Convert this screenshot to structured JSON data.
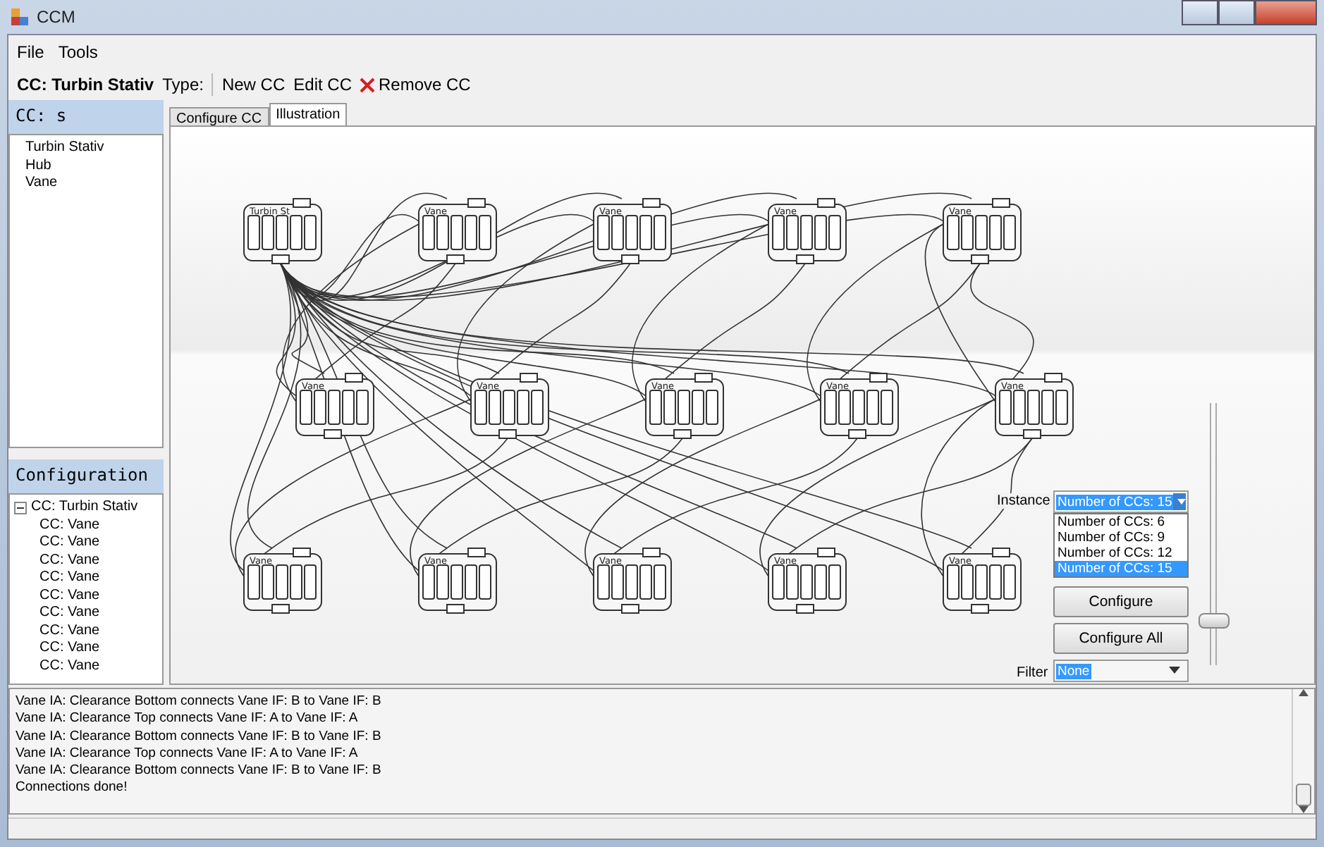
{
  "window": {
    "title": "CCM"
  },
  "menu": [
    "File",
    "Tools"
  ],
  "toolbar": {
    "current": "CC: Turbin Stativ",
    "type_label": "Type:",
    "actions": [
      {
        "label": "New CC",
        "kind": "plain"
      },
      {
        "label": "Edit CC",
        "kind": "plain"
      },
      {
        "label": "Remove CC",
        "kind": "remove"
      }
    ]
  },
  "cc_panel": {
    "title": "CC: s",
    "items": [
      {
        "label": "Turbin Stativ",
        "selected": false
      },
      {
        "label": "Hub",
        "selected": false
      },
      {
        "label": "Vane",
        "selected": false
      }
    ]
  },
  "configuration": {
    "title": "Configuration",
    "root": {
      "label": "CC: Turbin Stativ",
      "expanded": true,
      "children": [
        {
          "label": "CC: Vane"
        },
        {
          "label": "CC: Vane"
        },
        {
          "label": "CC: Vane"
        },
        {
          "label": "CC: Vane"
        },
        {
          "label": "CC: Vane"
        },
        {
          "label": "CC: Vane"
        },
        {
          "label": "CC: Vane"
        },
        {
          "label": "CC: Vane"
        },
        {
          "label": "CC: Vane"
        }
      ]
    }
  },
  "tabs": [
    {
      "label": "Configure CC",
      "selected": false
    },
    {
      "label": "Illustration",
      "selected": true
    }
  ],
  "diagram": {
    "nodes": [
      {
        "label": "Turbin St"
      },
      {
        "label": "Vane"
      },
      {
        "label": "Vane"
      },
      {
        "label": "Vane"
      },
      {
        "label": "Vane"
      },
      {
        "label": "Vane"
      },
      {
        "label": "Vane"
      },
      {
        "label": "Vane"
      },
      {
        "label": "Vane"
      },
      {
        "label": "Vane"
      },
      {
        "label": "Vane"
      },
      {
        "label": "Vane"
      },
      {
        "label": "Vane"
      },
      {
        "label": "Vane"
      },
      {
        "label": "Vane"
      }
    ]
  },
  "instance": {
    "label": "Instance",
    "value": "Number of CCs: 15",
    "options": [
      {
        "label": "Number of CCs: 6",
        "selected": false
      },
      {
        "label": "Number of CCs: 9",
        "selected": false
      },
      {
        "label": "Number of CCs: 12",
        "selected": false
      },
      {
        "label": "Number of CCs: 15",
        "selected": true
      }
    ]
  },
  "buttons": [
    "Configure",
    "Configure All"
  ],
  "filter": {
    "label": "Filter",
    "value": "None"
  },
  "zoom_slider": {
    "level": 0.17
  },
  "log": [
    "Vane IA: Clearance Bottom connects Vane IF: B to Vane IF: B",
    "Vane IA: Clearance Top connects Vane IF: A to Vane IF: A",
    "Vane IA: Clearance Bottom connects Vane IF: B to Vane IF: B",
    "Vane IA: Clearance Top connects Vane IF: A to Vane IF: A",
    "Vane IA: Clearance Bottom connects Vane IF: B to Vane IF: B",
    "Connections done!"
  ]
}
